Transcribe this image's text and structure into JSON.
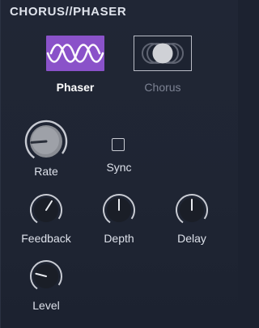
{
  "header": {
    "title": "CHORUS//PHASER"
  },
  "modes": {
    "phaser_label": "Phaser",
    "chorus_label": "Chorus",
    "selected": "Phaser",
    "phaser_icon": "sine-wave-icon",
    "chorus_icon": "overlapping-circles-icon"
  },
  "controls": {
    "rate": {
      "label": "Rate",
      "value": 0.15
    },
    "sync": {
      "label": "Sync",
      "checked": false
    },
    "feedback": {
      "label": "Feedback",
      "value": 0.62
    },
    "depth": {
      "label": "Depth",
      "value": 0.5
    },
    "delay": {
      "label": "Delay",
      "value": 0.5
    },
    "level": {
      "label": "Level",
      "value": 0.22
    }
  },
  "colors": {
    "accent": "#8a52c9",
    "background": "#1f2533",
    "knob_ring": "#c8cbd3",
    "label_selected": "#ffffff",
    "label_unselected": "#7d8393"
  }
}
